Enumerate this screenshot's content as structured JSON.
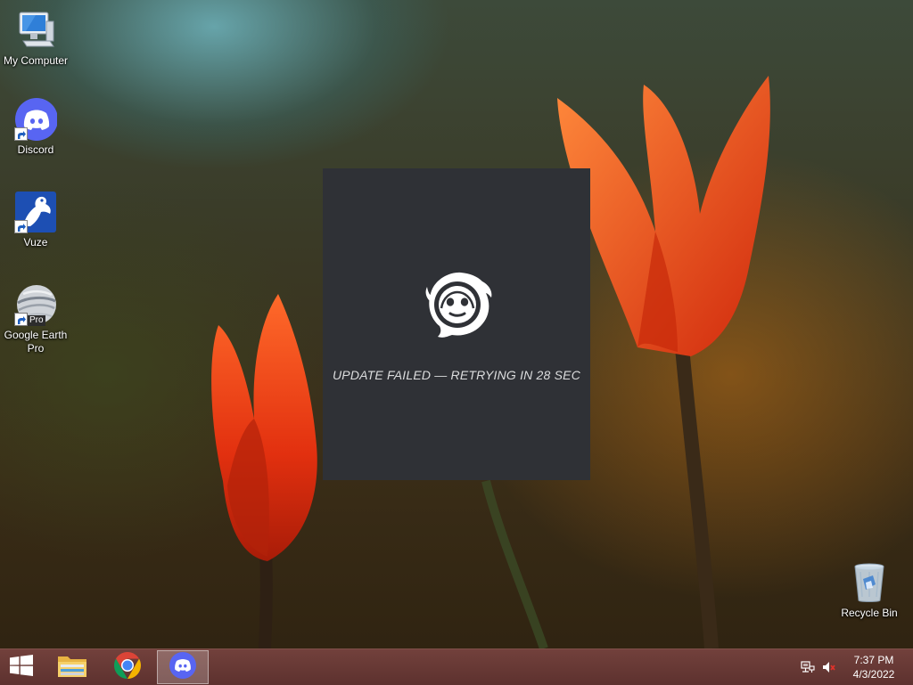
{
  "desktop": {
    "icons": [
      {
        "label": "My Computer",
        "icon": "computer-icon"
      },
      {
        "label": "Discord",
        "icon": "discord-icon"
      },
      {
        "label": "Vuze",
        "icon": "vuze-icon"
      },
      {
        "label": "Google Earth Pro",
        "icon": "google-earth-icon",
        "badge": "Pro"
      },
      {
        "label": "Recycle Bin",
        "icon": "recycle-bin-icon"
      }
    ]
  },
  "updater": {
    "status": "UPDATE FAILED — RETRYING IN 28 SEC",
    "icon": "discord-updater-logo-icon",
    "background": "#2f3136"
  },
  "taskbar": {
    "buttons": [
      {
        "name": "start",
        "icon": "windows-logo-icon"
      },
      {
        "name": "file-explorer",
        "icon": "folder-icon"
      },
      {
        "name": "chrome",
        "icon": "chrome-icon"
      },
      {
        "name": "discord",
        "icon": "discord-icon",
        "active": true
      }
    ],
    "tray": [
      {
        "name": "network",
        "icon": "network-icon"
      },
      {
        "name": "volume",
        "icon": "volume-muted-icon"
      }
    ],
    "clock": {
      "time": "7:37 PM",
      "date": "4/3/2022"
    }
  },
  "colors": {
    "discord": "#5865f2",
    "taskbar": "#6e3f3c",
    "updater_text": "#dcddde"
  }
}
